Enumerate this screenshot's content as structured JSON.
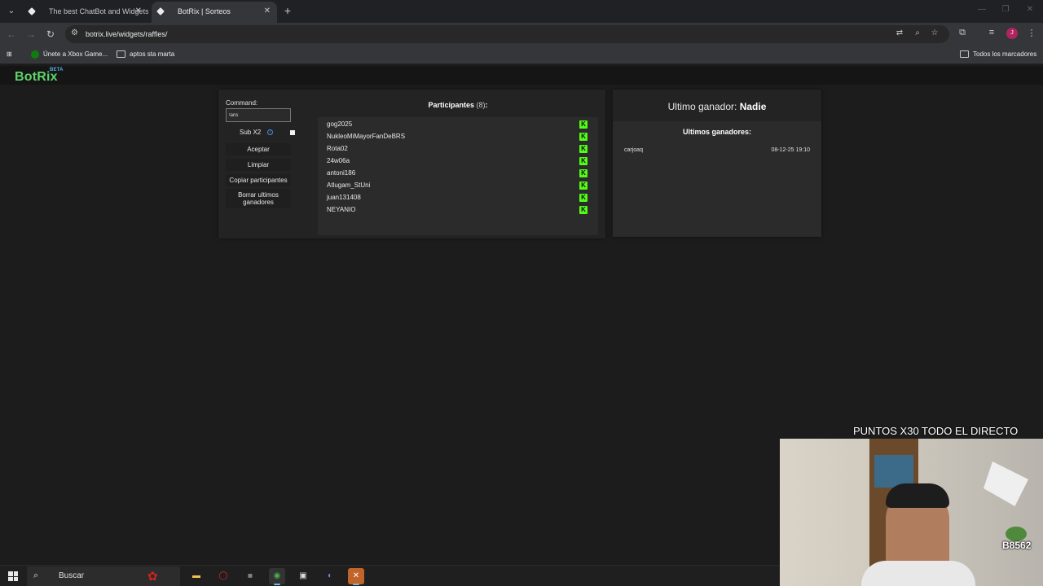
{
  "browser": {
    "tabs": [
      {
        "title": "The best ChatBot and Widgets",
        "active": false
      },
      {
        "title": "BotRix | Sorteos",
        "active": true
      }
    ],
    "url": "botrix.live/widgets/raffles/",
    "profile_initial": "J",
    "bookmarks": [
      {
        "label": "Únete a Xbox Game..."
      },
      {
        "label": "aptos sta marta"
      }
    ],
    "all_bookmarks_label": "Todos los marcadores"
  },
  "app": {
    "logo": "BotRix",
    "logo_badge": "BETA"
  },
  "controls": {
    "command_label": "Command:",
    "command_value": "!aris",
    "sub_label": "Sub X2",
    "sub_info_icon": "info-icon",
    "buttons": {
      "accept": "Aceptar",
      "clear": "Limpiar",
      "copy": "Copiar participantes",
      "delete_winners": "Borrar ultimos ganadores"
    }
  },
  "participants": {
    "title": "Participantes",
    "count_text": "(8)",
    "colon": ":",
    "platform_icon": "kick-icon",
    "platform_glyph": "K",
    "items": [
      "gog2025",
      "NukleoMiMayorFanDeBRS",
      "Rota02",
      "24w06a",
      "antoni186",
      "Atlugam_StUni",
      "juan131408",
      "NEYANIO"
    ]
  },
  "winners": {
    "last_winner_label": "Ultimo ganador:",
    "last_winner_name": "Nadie",
    "list_title": "Ultimos ganadores:",
    "rows": [
      {
        "name": "carjoaq",
        "date": "08-12-25 19:10"
      }
    ]
  },
  "stream_overlay": {
    "banner": "PUNTOS X30 TODO EL DIRECTO",
    "points_badge": "B8562"
  },
  "taskbar": {
    "search_placeholder": "Buscar"
  },
  "colors": {
    "accent_green": "#5ed36b",
    "kick_green": "#53fc18",
    "background": "#1c1c1c",
    "card": "#232323"
  }
}
